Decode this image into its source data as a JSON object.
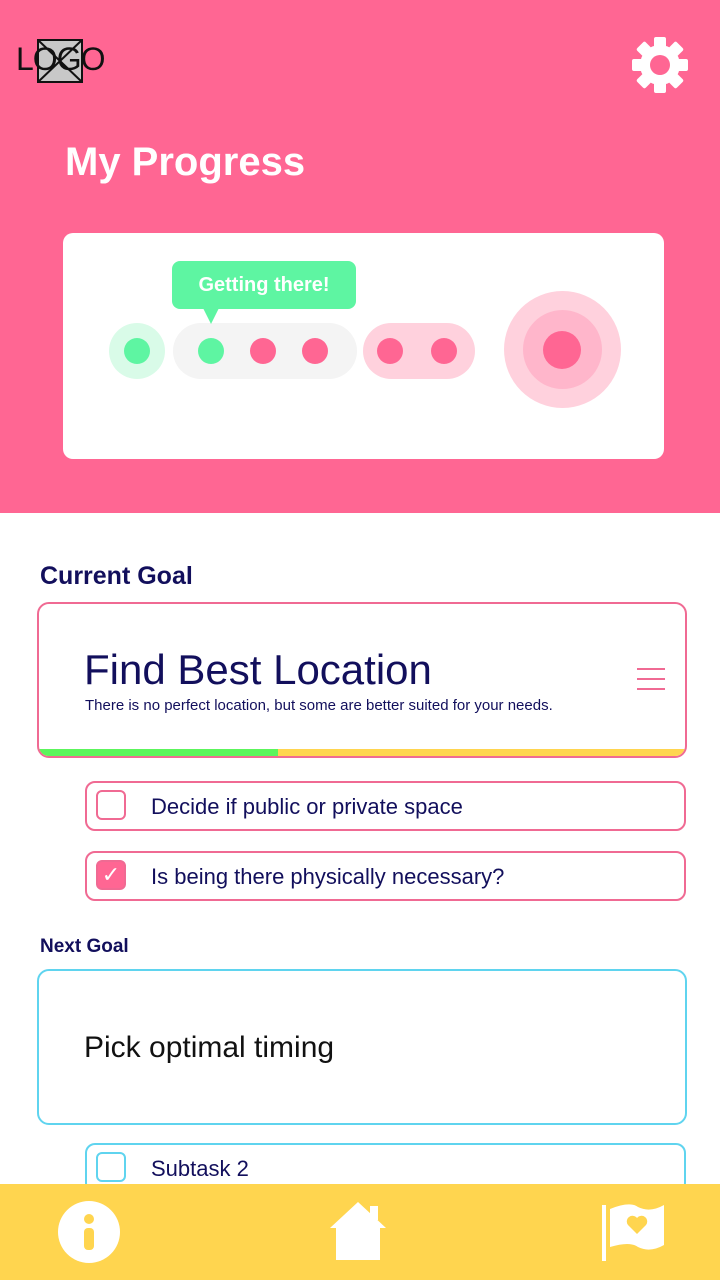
{
  "header": {
    "logo_text": "LOGO",
    "title": "My Progress",
    "settings_icon": "gear-icon"
  },
  "progress_tracker": {
    "tooltip": "Getting there!",
    "colors": {
      "completed": "#5ef5a2",
      "upcoming": "#ff6693",
      "final_goal": "#ff6693"
    }
  },
  "current_goal": {
    "section_label": "Current Goal",
    "title": "Find Best Location",
    "description": "There is no perfect location, but some are better suited for your needs.",
    "progress_fraction": 0.37,
    "menu_icon": "hamburger-menu-icon",
    "subtasks": [
      {
        "label": "Decide if public or private space",
        "checked": false
      },
      {
        "label": "Is being there physically necessary?",
        "checked": true
      }
    ]
  },
  "next_goal": {
    "section_label": "Next Goal",
    "title": "Pick optimal timing",
    "subtasks": [
      {
        "label": "Subtask 2",
        "checked": false
      }
    ]
  },
  "bottom_nav": {
    "items": [
      {
        "icon": "info-icon"
      },
      {
        "icon": "home-icon"
      },
      {
        "icon": "flag-heart-icon"
      }
    ]
  },
  "colors": {
    "header_bg": "#ff6693",
    "accent_pink": "#f06a93",
    "accent_blue": "#5fd4ef",
    "text_navy": "#120f5c",
    "nav_bg": "#ffd54f",
    "progress_fill": "#5cf55c"
  }
}
